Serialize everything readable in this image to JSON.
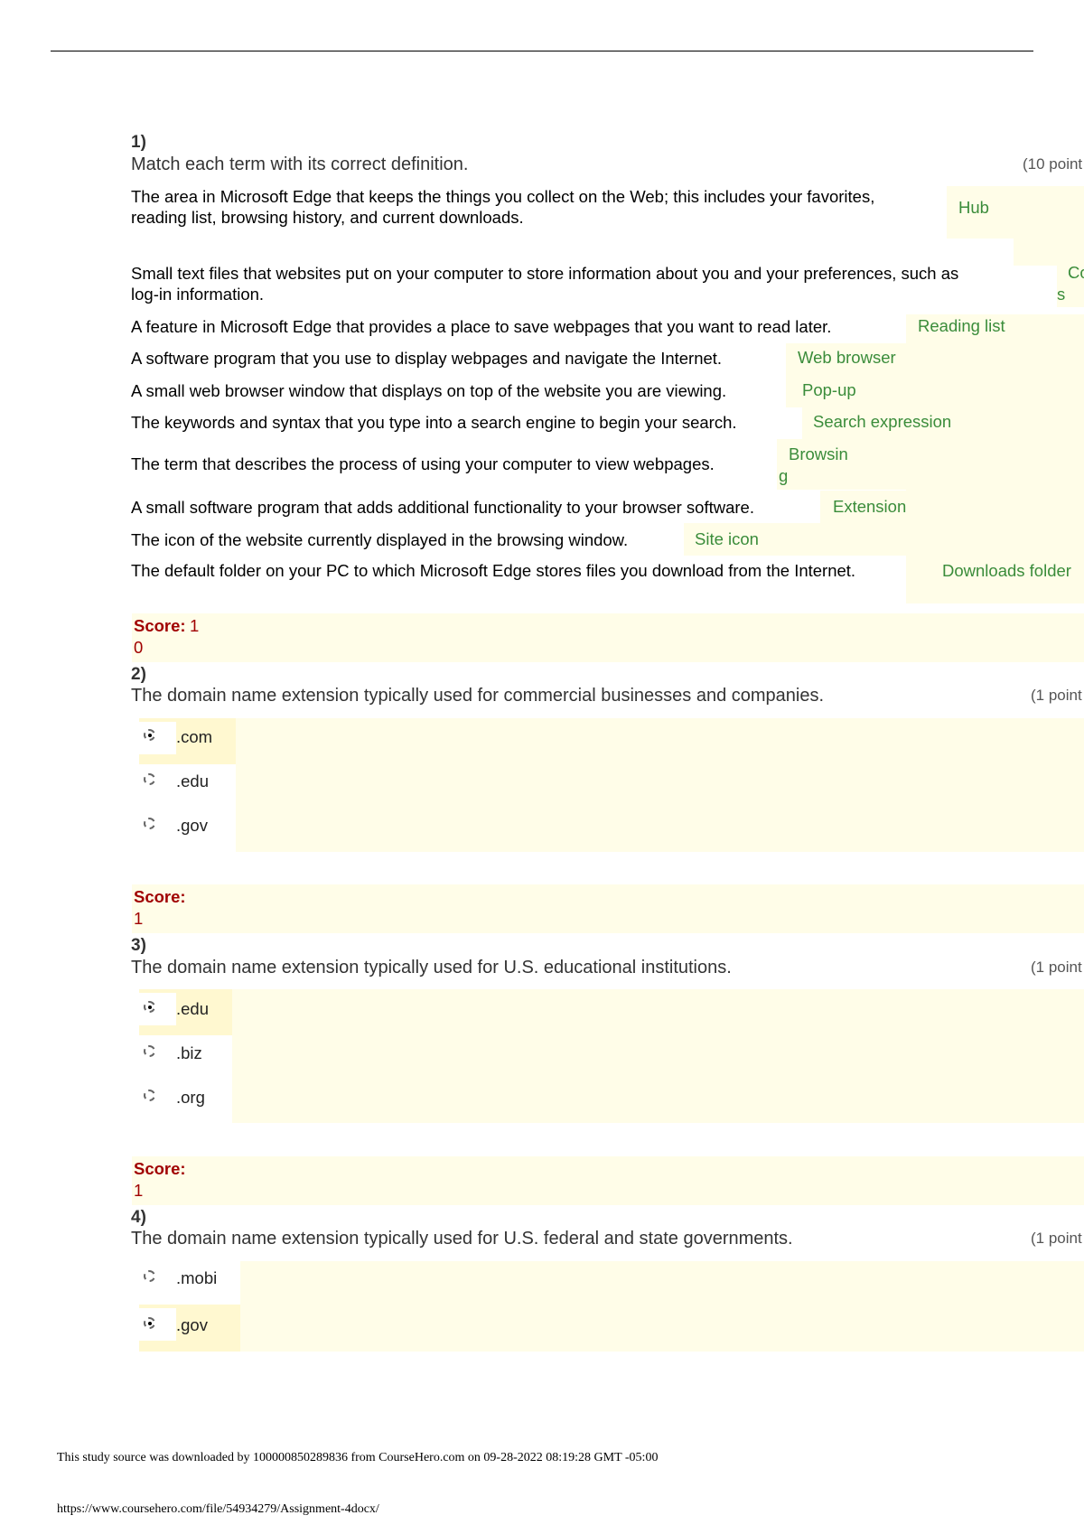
{
  "q1": {
    "number": "1)",
    "prompt": "Match each term with its correct definition.",
    "points": "(10 point",
    "items": [
      {
        "def1": "The area in Microsoft Edge that keeps the things you collect on the Web; this includes your favorites,",
        "def2": "reading list, browsing history, and current downloads.",
        "answer": "Hub"
      },
      {
        "def1": "Small text files that websites put on your computer to store information about you and your preferences, such as",
        "def2": "log-in information.",
        "answer": "Co",
        "answer2": "s"
      },
      {
        "def1": "A feature in Microsoft Edge that provides a place to save webpages that you want to read later.",
        "answer": "Reading list"
      },
      {
        "def1": "A software program that you use to display webpages and navigate the Internet.",
        "answer": "Web browser"
      },
      {
        "def1": "A small web browser window that displays on top of the website you are viewing.",
        "answer": "Pop-up"
      },
      {
        "def1": "The keywords and syntax that you type into a search engine to begin your search.",
        "answer": "Search expression"
      },
      {
        "def1": "The term that describes the process of using your computer to view webpages.",
        "answer": "Browsin",
        "answer2": "g"
      },
      {
        "def1": "A small software program that adds additional functionality to your browser software.",
        "answer": "Extension"
      },
      {
        "def1": "The icon of the website currently displayed in the browsing window.",
        "answer": "Site icon"
      },
      {
        "def1": "The default folder on your PC to which Microsoft Edge stores files you download from the Internet.",
        "answer": "Downloads folder"
      }
    ],
    "score_label": "Score:",
    "score_a": "1",
    "score_b": "0"
  },
  "q2": {
    "number": "2)",
    "prompt": "The domain name extension typically used for commercial businesses and companies.",
    "points": "(1 point",
    "options": [
      ".com",
      ".edu",
      ".gov"
    ],
    "selected": 0,
    "score_label": "Score:",
    "score": "1"
  },
  "q3": {
    "number": "3)",
    "prompt": "The domain name extension typically used for U.S. educational institutions.",
    "points": "(1 point",
    "options": [
      ".edu",
      ".biz",
      ".org"
    ],
    "selected": 0,
    "score_label": "Score:",
    "score": "1"
  },
  "q4": {
    "number": "4)",
    "prompt": "The domain name extension typically used for U.S. federal and state governments.",
    "points": "(1 point",
    "options": [
      ".mobi",
      ".gov"
    ],
    "selected": 1
  },
  "footer": {
    "source": "This study source was downloaded by 100000850289836 from CourseHero.com on 09-28-2022 08:19:28 GMT -05:00",
    "url": "https://www.coursehero.com/file/54934279/Assignment-4docx/"
  },
  "colors": {
    "answer": "#3a8c3a",
    "score": "#a00000",
    "highlight": "#fffde8"
  }
}
